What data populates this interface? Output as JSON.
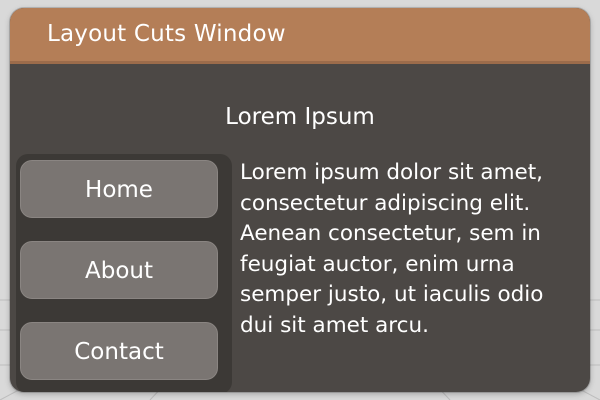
{
  "window": {
    "title": "Layout Cuts Window"
  },
  "main": {
    "heading": "Lorem Ipsum",
    "body_text": "Lorem ipsum dolor sit amet, consectetur adipiscing elit. Aenean consectetur, sem in feugiat auctor, enim urna semper justo, ut iaculis odio dui sit amet arcu."
  },
  "nav": {
    "items": [
      {
        "label": "Home"
      },
      {
        "label": "About"
      },
      {
        "label": "Contact"
      }
    ]
  },
  "colors": {
    "titlebar": "#b47e57",
    "window_background": "#4c4845",
    "nav_panel": "#3c3936",
    "button": "#7a7572",
    "text": "#ffffff"
  }
}
